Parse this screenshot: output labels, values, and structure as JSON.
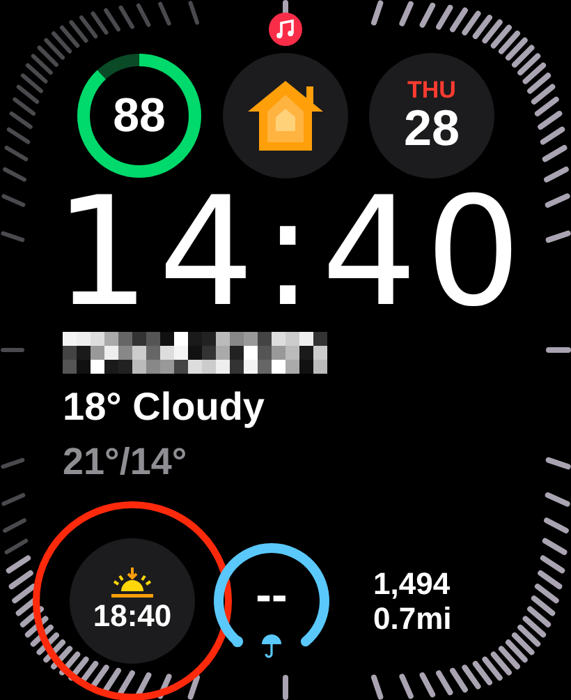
{
  "battery": {
    "value": "88",
    "level": 0.88
  },
  "date": {
    "weekday": "THU",
    "day": "28"
  },
  "time": "14:40",
  "weather": {
    "condition": "18° Cloudy",
    "range": "21°/14°"
  },
  "sunset": {
    "time": "18:40"
  },
  "rain": {
    "value": "--"
  },
  "activity": {
    "steps": "1,494",
    "distance": "0.7mi"
  }
}
